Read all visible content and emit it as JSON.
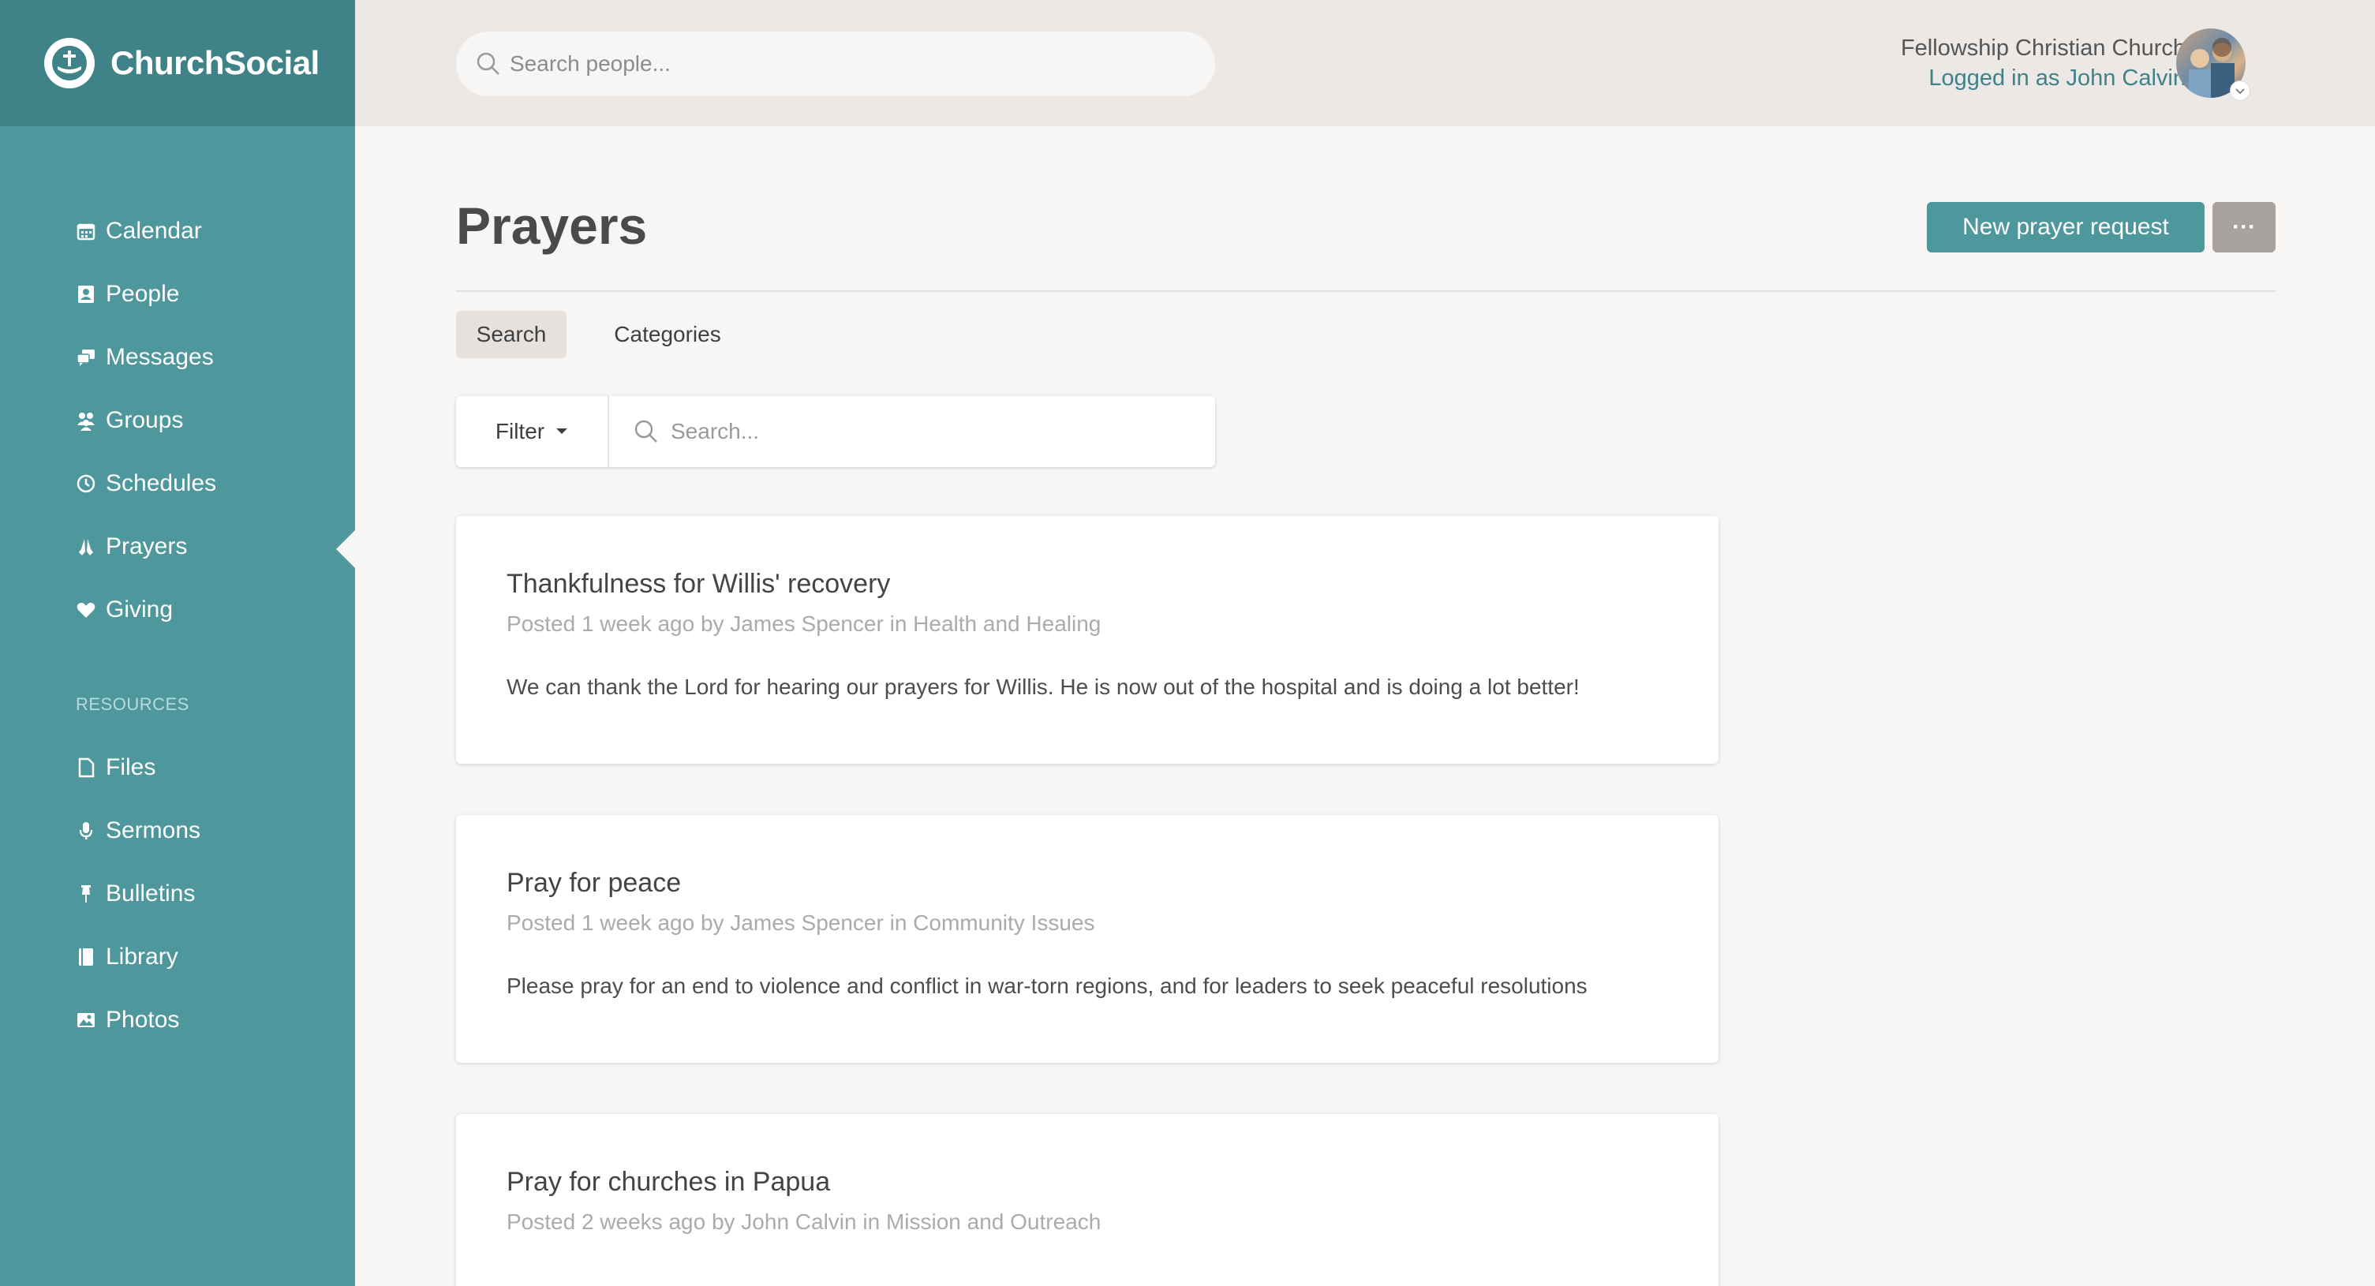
{
  "brand": {
    "name": "ChurchSocial"
  },
  "topbar": {
    "search_placeholder": "Search people...",
    "church_name": "Fellowship Christian Church",
    "logged_in": "Logged in as John Calvin"
  },
  "sidebar": {
    "items": [
      {
        "label": "Calendar",
        "icon": "calendar-icon"
      },
      {
        "label": "People",
        "icon": "people-icon"
      },
      {
        "label": "Messages",
        "icon": "messages-icon"
      },
      {
        "label": "Groups",
        "icon": "groups-icon"
      },
      {
        "label": "Schedules",
        "icon": "clock-icon"
      },
      {
        "label": "Prayers",
        "icon": "praying-hands-icon",
        "active": true
      },
      {
        "label": "Giving",
        "icon": "heart-icon"
      }
    ],
    "resources_label": "RESOURCES",
    "resources": [
      {
        "label": "Files",
        "icon": "file-icon"
      },
      {
        "label": "Sermons",
        "icon": "microphone-icon"
      },
      {
        "label": "Bulletins",
        "icon": "pin-icon"
      },
      {
        "label": "Library",
        "icon": "book-icon"
      },
      {
        "label": "Photos",
        "icon": "image-icon"
      }
    ]
  },
  "main": {
    "title": "Prayers",
    "new_button": "New prayer request",
    "more_button": "···",
    "tabs": [
      {
        "label": "Search",
        "active": true
      },
      {
        "label": "Categories",
        "active": false
      }
    ],
    "filter": {
      "label": "Filter",
      "search_placeholder": "Search..."
    },
    "prayers": [
      {
        "title": "Thankfulness for Willis' recovery",
        "meta": "Posted 1 week ago by James Spencer in Health and Healing",
        "body": "We can thank the Lord for hearing our prayers for Willis. He is now out of the hospital and is doing a lot better!"
      },
      {
        "title": "Pray for peace",
        "meta": "Posted 1 week ago by James Spencer in Community Issues",
        "body": "Please pray for an end to violence and conflict in war-torn regions, and for leaders to seek peaceful resolutions"
      },
      {
        "title": "Pray for churches in Papua",
        "meta": "Posted 2 weeks ago by John Calvin in Mission and Outreach",
        "body": ""
      }
    ]
  },
  "colors": {
    "sidebar": "#4e979c",
    "brand_bar": "#3f8287",
    "accent": "#4e979c",
    "topbar": "#ebe8e6",
    "page_bg": "#f7f6f5"
  }
}
